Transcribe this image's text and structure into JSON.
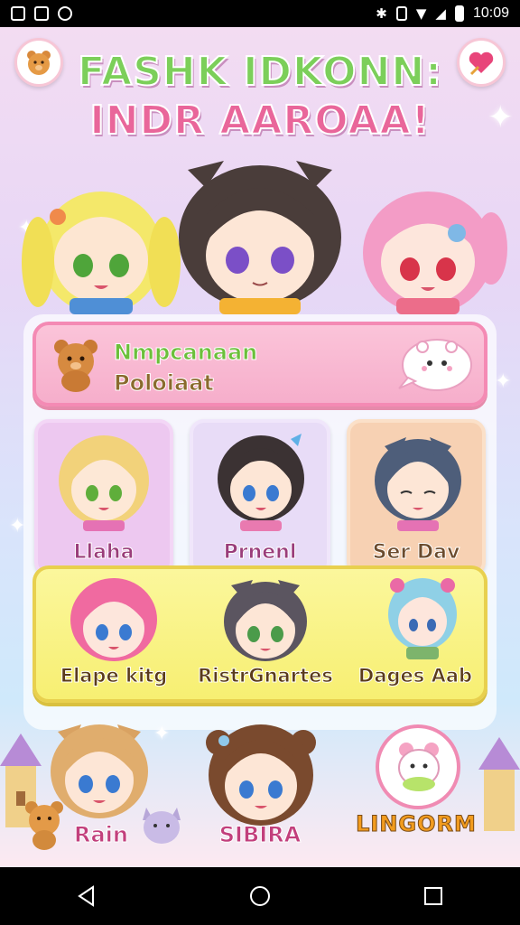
{
  "status_bar": {
    "time": "10:09"
  },
  "header": {
    "title_line1": "FASHK IDKONN:",
    "title_line2": "INDR AAROAA!"
  },
  "banner": {
    "title": "Nmpcanaan",
    "subtitle": "Poloiaat"
  },
  "cards": [
    {
      "label": "Llaha"
    },
    {
      "label": "Prnenl"
    },
    {
      "label": "Ser Dav"
    }
  ],
  "featured": [
    {
      "label": "Elape kitg"
    },
    {
      "label": "RistrGnartes"
    },
    {
      "label": "Dages Aab"
    }
  ],
  "bottom": {
    "left_label": "Rain",
    "center_label": "SIBIRA",
    "logo_text": "LINGORM"
  },
  "colors": {
    "accent_pink": "#f48ab4",
    "accent_yellow": "#f7ef72",
    "title_green": "#7ccf5a",
    "title_pink": "#e9669a"
  }
}
